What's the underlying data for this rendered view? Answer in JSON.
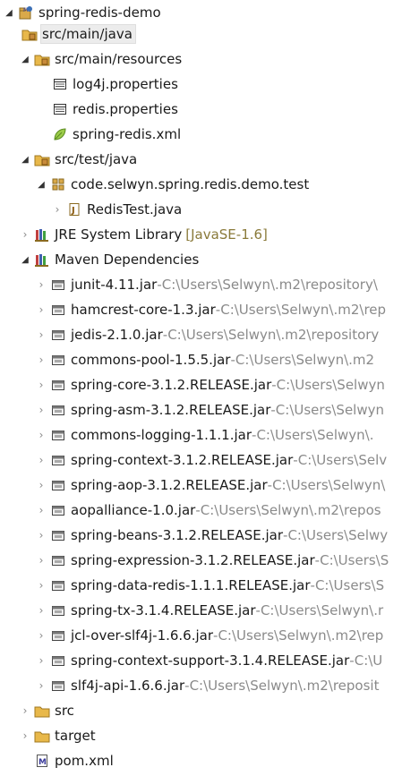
{
  "tree": {
    "root": {
      "label": "spring-redis-demo"
    },
    "src_main_java": {
      "label": "src/main/java"
    },
    "src_main_resources": {
      "label": "src/main/resources"
    },
    "res_files": [
      {
        "label": "log4j.properties"
      },
      {
        "label": "redis.properties"
      },
      {
        "label": "spring-redis.xml"
      }
    ],
    "src_test_java": {
      "label": "src/test/java"
    },
    "test_package": {
      "label": "code.selwyn.spring.redis.demo.test"
    },
    "test_class": {
      "label": "RedisTest.java"
    },
    "jre": {
      "label": "JRE System Library",
      "decoration": "[JavaSE-1.6]"
    },
    "maven": {
      "label": "Maven Dependencies"
    },
    "jars": [
      {
        "name": "junit-4.11.jar",
        "sep": " - ",
        "path": "C:\\Users\\Selwyn\\.m2\\repository\\"
      },
      {
        "name": "hamcrest-core-1.3.jar",
        "sep": " - ",
        "path": "C:\\Users\\Selwyn\\.m2\\rep"
      },
      {
        "name": "jedis-2.1.0.jar",
        "sep": " - ",
        "path": "C:\\Users\\Selwyn\\.m2\\repository"
      },
      {
        "name": "commons-pool-1.5.5.jar",
        "sep": " - ",
        "path": "C:\\Users\\Selwyn\\.m2"
      },
      {
        "name": "spring-core-3.1.2.RELEASE.jar",
        "sep": " - ",
        "path": "C:\\Users\\Selwyn"
      },
      {
        "name": "spring-asm-3.1.2.RELEASE.jar",
        "sep": " - ",
        "path": "C:\\Users\\Selwyn"
      },
      {
        "name": "commons-logging-1.1.1.jar",
        "sep": " - ",
        "path": "C:\\Users\\Selwyn\\."
      },
      {
        "name": "spring-context-3.1.2.RELEASE.jar",
        "sep": " - ",
        "path": "C:\\Users\\Selv"
      },
      {
        "name": "spring-aop-3.1.2.RELEASE.jar",
        "sep": " - ",
        "path": "C:\\Users\\Selwyn\\"
      },
      {
        "name": "aopalliance-1.0.jar",
        "sep": " - ",
        "path": "C:\\Users\\Selwyn\\.m2\\repos"
      },
      {
        "name": "spring-beans-3.1.2.RELEASE.jar",
        "sep": " - ",
        "path": "C:\\Users\\Selwy"
      },
      {
        "name": "spring-expression-3.1.2.RELEASE.jar",
        "sep": " - ",
        "path": "C:\\Users\\S"
      },
      {
        "name": "spring-data-redis-1.1.1.RELEASE.jar",
        "sep": " - ",
        "path": "C:\\Users\\S"
      },
      {
        "name": "spring-tx-3.1.4.RELEASE.jar",
        "sep": " - ",
        "path": "C:\\Users\\Selwyn\\.r"
      },
      {
        "name": "jcl-over-slf4j-1.6.6.jar",
        "sep": " - ",
        "path": "C:\\Users\\Selwyn\\.m2\\rep"
      },
      {
        "name": "spring-context-support-3.1.4.RELEASE.jar",
        "sep": " - ",
        "path": "C:\\U"
      },
      {
        "name": "slf4j-api-1.6.6.jar",
        "sep": " - ",
        "path": "C:\\Users\\Selwyn\\.m2\\reposit"
      }
    ],
    "src": {
      "label": "src"
    },
    "target": {
      "label": "target"
    },
    "pom": {
      "label": "pom.xml"
    }
  },
  "icons": {
    "expanded": "triangle-down-icon",
    "collapsed": "chevron-right-icon",
    "project": "maven-project-icon",
    "source_folder": "source-folder-icon",
    "package": "package-icon",
    "properties_file": "properties-file-icon",
    "xml_spring": "spring-leaf-icon",
    "java_file": "java-file-icon",
    "library": "library-icon",
    "jar": "jar-icon",
    "folder": "folder-icon",
    "pom": "maven-pom-icon"
  },
  "colors": {
    "selection_bg": "#ececec",
    "path_text": "#8a8a8a",
    "decoration_text": "#8a7a3a",
    "folder": "#e8b84a"
  }
}
